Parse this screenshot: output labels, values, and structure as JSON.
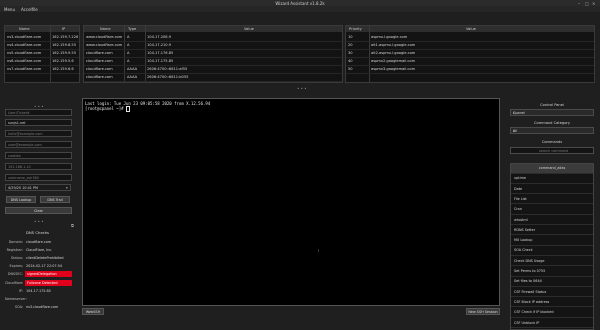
{
  "window": {
    "title": "Wizard Assistant v1.8.2k",
    "controls": [
      "–",
      "□",
      "×"
    ]
  },
  "menu": [
    {
      "label": "Menu"
    },
    {
      "label": "Accelfile"
    }
  ],
  "table_a": {
    "headers": [
      "Name",
      "IP"
    ],
    "rows": [
      {
        "name": "ns3.cloudflare.com",
        "ip": "162.159.7.226"
      },
      {
        "name": "ns4.cloudflare.com",
        "ip": "162.159.8.55"
      },
      {
        "name": "ns5.cloudflare.com",
        "ip": "162.159.9.55"
      },
      {
        "name": "ns6.cloudflare.com",
        "ip": "162.159.5.6"
      },
      {
        "name": "ns7.cloudflare.com",
        "ip": "162.159.6.6"
      }
    ]
  },
  "table_b": {
    "headers": [
      "Name",
      "Type",
      "Value"
    ],
    "rows": [
      {
        "name": "www.cloudflare.com",
        "type": "A",
        "value": "104.17.208.9"
      },
      {
        "name": "www.cloudflare.com",
        "type": "A",
        "value": "104.17.210.9"
      },
      {
        "name": "cloudflare.com",
        "type": "A",
        "value": "104.17.176.85"
      },
      {
        "name": "cloudflare.com",
        "type": "A",
        "value": "104.17.175.85"
      },
      {
        "name": "cloudflare.com",
        "type": "AAAA",
        "value": "2606:4700::6811:af55"
      },
      {
        "name": "cloudflare.com",
        "type": "AAAA",
        "value": "2606:4700::6811:b055"
      }
    ]
  },
  "table_c": {
    "headers": [
      "Priority",
      "Value"
    ],
    "rows": [
      {
        "priority": "10",
        "value": "aspmx.l.google.com"
      },
      {
        "priority": "20",
        "value": "alt1.aspmx.l.google.com"
      },
      {
        "priority": "30",
        "value": "alt2.aspmx.l.google.com"
      },
      {
        "priority": "40",
        "value": "aspmx2.googlemail.com"
      },
      {
        "priority": "50",
        "value": "aspmx3.googlemail.com"
      }
    ]
  },
  "form": {
    "fields": [
      {
        "placeholder": "User/Ticket#",
        "value": ""
      },
      {
        "placeholder": "",
        "value": "sunjs1.net"
      },
      {
        "placeholder": "hello@example.com",
        "value": ""
      },
      {
        "placeholder": "user@example.com",
        "value": ""
      },
      {
        "placeholder": "cookies",
        "value": ""
      },
      {
        "placeholder": "192.168.1.10",
        "value": ""
      },
      {
        "placeholder": "username_ssh360",
        "value": ""
      }
    ],
    "datetime": "4/29/20 10:41 PM",
    "btn_dns_lookup": "DNS Lookup",
    "btn_dns_trail": "DNS Trail",
    "btn_clear": "Clear"
  },
  "dns_checks": {
    "title": "DNS Checks",
    "rows": [
      {
        "key": "Domain:",
        "value": "cloudflare.com",
        "status": ""
      },
      {
        "key": "Registrar:",
        "value": "CloudFlare, Inc.",
        "status": ""
      },
      {
        "key": "Status:",
        "value": "clientDeleteProhibited",
        "status": ""
      },
      {
        "key": "Expires:",
        "value": "2024-02-17 22:07:54",
        "status": ""
      },
      {
        "key": "DNSSEC:",
        "value": "signedDelegation",
        "status": "bad"
      },
      {
        "key": "Cloudflare:",
        "value": "Fullzone Detected",
        "status": "bad"
      },
      {
        "key": "IP:",
        "value": "104.17.175.85",
        "status": ""
      },
      {
        "key": "Nameserver:",
        "value": "",
        "status": ""
      },
      {
        "key": "SOA:",
        "value": "ns3.cloudflare.com",
        "status": ""
      }
    ]
  },
  "terminal": {
    "lines": [
      "Last login: Tue Jun 23 09:05:58 2020 from X.12.56.94",
      "[root@cpanel ~]# "
    ],
    "btn_left": "WebSSH",
    "btn_right": "New SSH Session"
  },
  "right_panel": {
    "control_panel_label": "Control Panel",
    "control_panel_value": "Cpanel",
    "category_label": "Command Category",
    "category_value": "All",
    "commands_label": "Commands",
    "search_placeholder": "search command",
    "commands": [
      "command_alias",
      "uptime",
      "Date",
      "File List",
      "Cron",
      "whoAmI",
      "RDNS Setter",
      "MX Lookup",
      "SOA Check",
      "Check DNS Usage",
      "Set Perms to 0755",
      "Set files to 0644",
      "CSF Firewall Status",
      "CSF Block IP address",
      "CSF Check if IP blocked",
      "CSF Unblock IP"
    ]
  }
}
